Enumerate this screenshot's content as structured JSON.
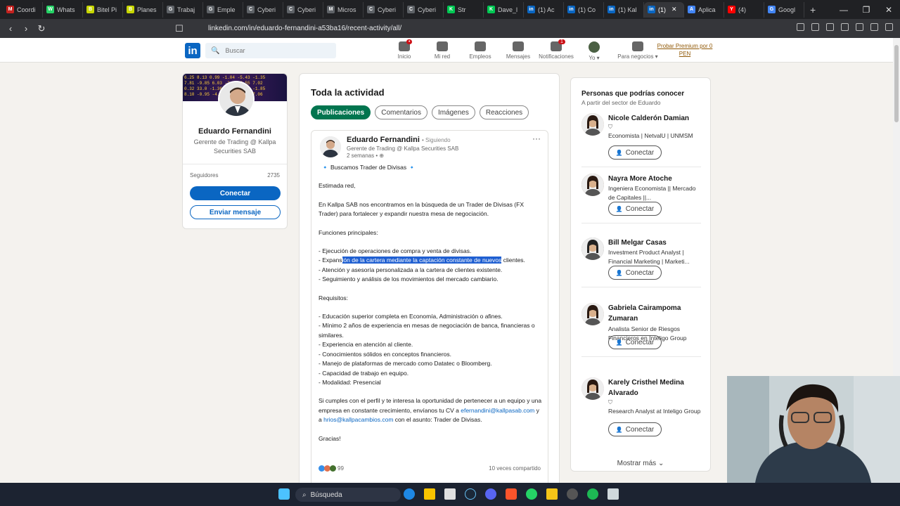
{
  "browser": {
    "tabs": [
      {
        "label": "Coordi",
        "color": "#c5221f",
        "glyph": "M"
      },
      {
        "label": "Whats",
        "color": "#25d366",
        "glyph": "W"
      },
      {
        "label": "Bitel Pi",
        "color": "#c7d600",
        "glyph": "B"
      },
      {
        "label": "Planes",
        "color": "#c7d600",
        "glyph": "B"
      },
      {
        "label": "Trabaj",
        "color": "#5f6368",
        "glyph": "G"
      },
      {
        "label": "Emple",
        "color": "#5f6368",
        "glyph": "G"
      },
      {
        "label": "Cyberi",
        "color": "#5f6368",
        "glyph": "C"
      },
      {
        "label": "Cyberi",
        "color": "#5f6368",
        "glyph": "C"
      },
      {
        "label": "Micros",
        "color": "#5f6368",
        "glyph": "M"
      },
      {
        "label": "Cyberi",
        "color": "#5f6368",
        "glyph": "C"
      },
      {
        "label": "Cyberi",
        "color": "#5f6368",
        "glyph": "C"
      },
      {
        "label": "Str",
        "color": "#00c853",
        "glyph": "K"
      },
      {
        "label": "Dave_l",
        "color": "#00c853",
        "glyph": "K"
      },
      {
        "label": "(1) Ac",
        "color": "#0a66c2",
        "glyph": "in"
      },
      {
        "label": "(1) Co",
        "color": "#0a66c2",
        "glyph": "in"
      },
      {
        "label": "(1) Kal",
        "color": "#0a66c2",
        "glyph": "in"
      },
      {
        "label": "(1)",
        "color": "#0a66c2",
        "glyph": "in",
        "active": true
      },
      {
        "label": "Aplica",
        "color": "#4285f4",
        "glyph": "A"
      },
      {
        "label": "(4)",
        "color": "#ff0000",
        "glyph": "Y"
      },
      {
        "label": "Googl",
        "color": "#4285f4",
        "glyph": "G"
      }
    ],
    "url": "linkedin.com/in/eduardo-fernandini-a53ba16/recent-activity/all/"
  },
  "header": {
    "logo": "in",
    "search_placeholder": "Buscar",
    "nav": [
      {
        "label": "Inicio",
        "badge": "•"
      },
      {
        "label": "Mi red",
        "badge": ""
      },
      {
        "label": "Empleos",
        "badge": ""
      },
      {
        "label": "Mensajes",
        "badge": ""
      },
      {
        "label": "Notificaciones",
        "badge": "1"
      },
      {
        "label": "Yo ▾",
        "badge": ""
      },
      {
        "label": "Para negocios ▾",
        "badge": ""
      }
    ],
    "premium": "Probar Premium por 0 PEN"
  },
  "profile": {
    "name": "Eduardo Fernandini",
    "headline": "Gerente de Trading @ Kallpa Securities SAB",
    "followers_label": "Seguidores",
    "followers_count": "2735",
    "connect": "Conectar",
    "message": "Enviar mensaje",
    "ticker_rows": [
      "6.25 8.13 0.99 -1.04 -5.43 -1.35",
      "7.81 -9.85 6.03 -2.61 6.55 7.02",
      "0.32 33.0 -1.36 -2.4 -6.55 -1.85",
      "8.10 -0.95 -4.13 -2.9 8.45 7.06"
    ]
  },
  "main": {
    "title": "Toda la actividad",
    "filters": [
      {
        "label": "Publicaciones",
        "active": true
      },
      {
        "label": "Comentarios"
      },
      {
        "label": "Imágenes"
      },
      {
        "label": "Reacciones"
      }
    ],
    "post": {
      "author": "Eduardo Fernandini",
      "following": "• Siguiendo",
      "headline": "Gerente de Trading @ Kallpa Securities SAB",
      "time": "2 semanas • ",
      "more": "···",
      "title": "🔹 Buscamos Trader de Divisas 🔹",
      "greeting": "Estimada red,",
      "intro": "En Kallpa SAB nos encontramos en la búsqueda de un Trader de Divisas (FX Trader) para fortalecer y expandir nuestra mesa de negociación.",
      "functions_title": "Funciones principales:",
      "functions": [
        "- Ejecución de operaciones de compra y venta de divisas.",
        "- Atención y asesoría personalizada a la cartera de clientes existente.",
        "- Seguimiento y análisis de los movimientos del mercado cambiario."
      ],
      "expansion_pre": "- Expans",
      "expansion_hl": "ión de la cartera mediante la captación constante de nuevos",
      "expansion_post": " clientes.",
      "requirements_title": "Requisitos:",
      "requirements": [
        "- Educación superior completa en Economía, Administración o afines.",
        "- Mínimo 2 años de experiencia en mesas de negociación de banca, financieras o similares.",
        "- Experiencia en atención al cliente.",
        "- Conocimientos sólidos en conceptos financieros.",
        "- Manejo de plataformas de mercado como Datatec o Bloomberg.",
        "- Capacidad de trabajo en equipo.",
        "- Modalidad: Presencial"
      ],
      "closing_pre": "Si cumples con el perfil y te interesa la oportunidad de pertenecer a un equipo y una empresa en constante crecimiento, envíanos tu CV a ",
      "email1": "efernandini@kallpasab.com",
      "closing_mid": " y a ",
      "email2": "hrios@kallpacambios.com",
      "closing_post": " con el asunto: Trader de Divisas.",
      "thanks": "Gracias!",
      "reactions_count": "99",
      "shares": "10 veces compartido"
    }
  },
  "suggestions": {
    "title": "Personas que podrías conocer",
    "subtitle": "A partir del sector de Eduardo",
    "connect": "Conectar",
    "more": "Mostrar más",
    "people": [
      {
        "name": "Nicole Calderón Damian",
        "verified": true,
        "headline": "Economista | NetvalU | UNMSM",
        "bg": "#b89a82"
      },
      {
        "name": "Nayra More Atoche",
        "verified": false,
        "headline": "Ingeniera Economista || Mercado de Capitales ||...",
        "bg": "#8a6a56"
      },
      {
        "name": "Bill Melgar Casas",
        "verified": false,
        "headline": "Investment Product Analyst | Financial Marketing | Marketi...",
        "bg": "#6e6e6e"
      },
      {
        "name": "Gabriela Cairampoma Zumaran",
        "verified": false,
        "headline": "Analista Senior de Riesgos Financieros en Inteligo Group",
        "bg": "#b09784"
      },
      {
        "name": "Karely Cristhel Medina Alvarado",
        "verified": true,
        "headline": "Research Analyst at Inteligo Group",
        "bg": "#d7a9b8"
      }
    ]
  },
  "taskbar": {
    "search": "Búsqueda"
  }
}
